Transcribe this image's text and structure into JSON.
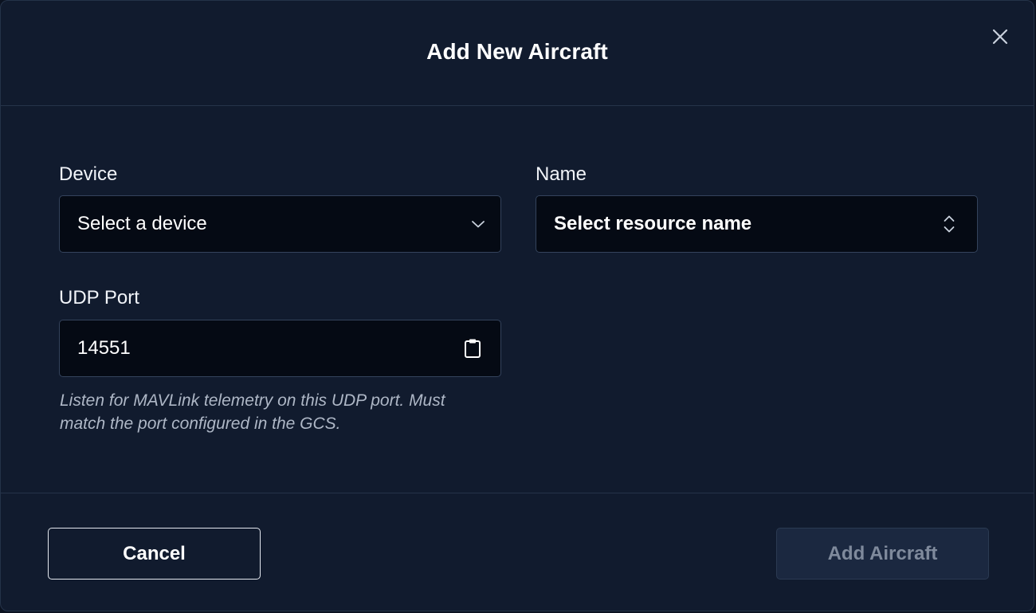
{
  "dialog": {
    "title": "Add New Aircraft",
    "close_icon": "close-icon"
  },
  "form": {
    "device": {
      "label": "Device",
      "placeholder": "Select a device",
      "icon": "chevron-down-icon"
    },
    "name": {
      "label": "Name",
      "placeholder": "Select resource name",
      "icon": "up-down-chevron-icon"
    },
    "udp_port": {
      "label": "UDP Port",
      "value": "14551",
      "icon": "clipboard-icon",
      "help": "Listen for MAVLink telemetry on this UDP port. Must match the port configured in the GCS."
    }
  },
  "footer": {
    "cancel_label": "Cancel",
    "add_label": "Add Aircraft",
    "add_disabled": true
  },
  "colors": {
    "background": "#111b2e",
    "field_background": "#050a14",
    "border": "#34435c",
    "disabled_button": "#1b2840",
    "disabled_text": "#7f8a9c"
  }
}
